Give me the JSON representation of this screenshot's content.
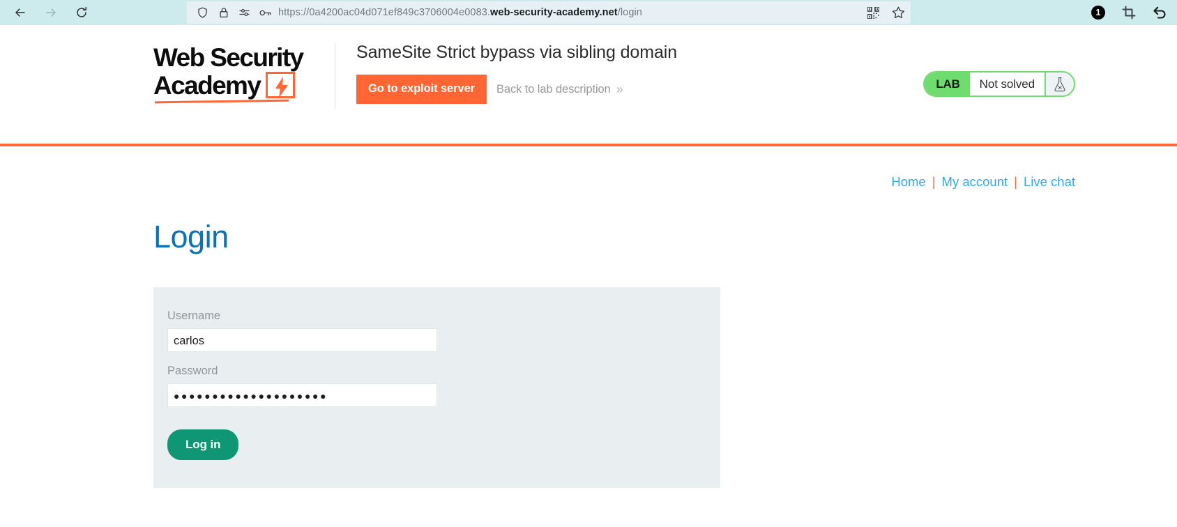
{
  "browser": {
    "back_icon": "back-arrow-icon",
    "forward_icon": "forward-arrow-icon",
    "reload_icon": "reload-icon",
    "shield_icon": "shield-icon",
    "lock_icon": "lock-icon",
    "permissions_icon": "permissions-sliders-icon",
    "key_icon": "key-icon",
    "qr_icon": "qr-code-icon",
    "bookmark_icon": "star-bookmark-icon",
    "extension_badge_count": "1",
    "crop_icon": "crop-extension-icon",
    "undo_icon": "undo-arrow-icon",
    "url_scheme": "https://0a4200ac04d071ef849c3706004e0083.",
    "url_host": "web-security-academy.net",
    "url_path": "/login",
    "url_full": "https://0a4200ac04d071ef849c3706004e0083.web-security-academy.net/login"
  },
  "lab_header": {
    "logo_line1": "Web Security",
    "logo_line2": "Academy",
    "logo_bolt_icon": "lightning-bolt-icon",
    "title": "SameSite Strict bypass via sibling domain",
    "exploit_button": "Go to exploit server",
    "back_link": "Back to lab description",
    "back_chevron": "»",
    "status_tag": "LAB",
    "status_value": "Not solved",
    "flask_icon": "flask-icon",
    "accent_color": "#ff6633",
    "status_color": "#6fdc6f"
  },
  "nav": {
    "links": [
      "Home",
      "My account",
      "Live chat"
    ],
    "separator": "|"
  },
  "page": {
    "title": "Login"
  },
  "form": {
    "username_label": "Username",
    "username_value": "carlos",
    "password_label": "Password",
    "password_value": "●●●●●●●●●●●●●●●●●●●●",
    "submit_label": "Log in"
  }
}
